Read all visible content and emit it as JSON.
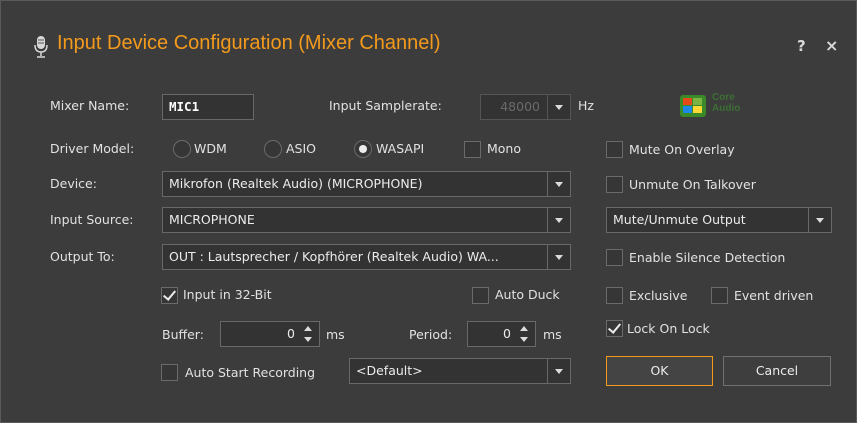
{
  "window": {
    "title": "Input Device Configuration (Mixer Channel)",
    "help_label": "?",
    "close_label": "×"
  },
  "mixer_name": {
    "label": "Mixer Name:",
    "value": "MIC1"
  },
  "samplerate": {
    "label": "Input Samplerate:",
    "value": "48000",
    "unit": "Hz"
  },
  "core_audio": {
    "line1": "Core",
    "line2": "Audio"
  },
  "driver_model": {
    "label": "Driver Model:",
    "options": [
      "WDM",
      "ASIO",
      "WASAPI"
    ],
    "selected": "WASAPI",
    "mono_label": "Mono"
  },
  "device": {
    "label": "Device:",
    "value": "Mikrofon (Realtek Audio) (MICROPHONE)"
  },
  "input_source": {
    "label": "Input Source:",
    "value": "MICROPHONE"
  },
  "output_to": {
    "label": "Output To:",
    "value": "OUT  : Lautsprecher / Kopfhörer (Realtek Audio) WA..."
  },
  "input_32bit": {
    "label": "Input in 32-Bit",
    "checked": true
  },
  "auto_duck": {
    "label": "Auto Duck",
    "checked": false
  },
  "buffer": {
    "label": "Buffer:",
    "value": "0",
    "unit": "ms"
  },
  "period": {
    "label": "Period:",
    "value": "0",
    "unit": "ms"
  },
  "auto_start_recording": {
    "label": "Auto Start Recording",
    "checked": false,
    "value": "<Default>"
  },
  "right_panel": {
    "mute_on_overlay": {
      "label": "Mute On Overlay",
      "checked": false
    },
    "unmute_on_talkover": {
      "label": "Unmute On Talkover",
      "checked": false
    },
    "mute_output": {
      "value": "Mute/Unmute Output"
    },
    "silence_detection": {
      "label": "Enable Silence Detection",
      "checked": false
    },
    "exclusive": {
      "label": "Exclusive",
      "checked": false
    },
    "event_driven": {
      "label": "Event driven",
      "checked": false
    },
    "lock_on_lock": {
      "label": "Lock On Lock",
      "checked": true
    }
  },
  "buttons": {
    "ok": "OK",
    "cancel": "Cancel"
  },
  "colors": {
    "accent": "#f39a1c",
    "background": "#3c3c3c",
    "field": "#333333",
    "border": "#686868"
  }
}
